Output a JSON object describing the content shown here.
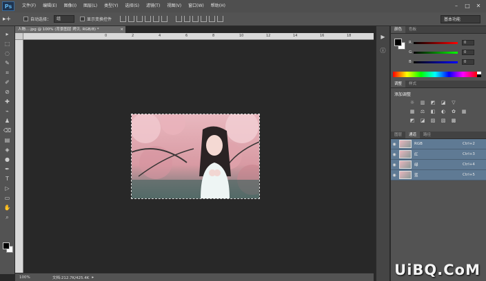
{
  "app": {
    "logo": "Ps",
    "menu": [
      "文件(F)",
      "编辑(E)",
      "图像(I)",
      "图层(L)",
      "类型(Y)",
      "选择(S)",
      "滤镜(T)",
      "视图(V)",
      "窗口(W)",
      "帮助(H)"
    ],
    "window_controls": [
      "–",
      "□",
      "✕"
    ]
  },
  "options": {
    "tool_glyph": "▸+",
    "auto_select_label": "自动选择：",
    "auto_select_value": "组",
    "show_transform_label": "显示变换控件",
    "workspace": "基本功能"
  },
  "tools": [
    "▸",
    "⬚",
    "◌",
    "✎",
    "⌗",
    "✐",
    "⊘",
    "✚",
    "⌁",
    "♟",
    "⌫",
    "▤",
    "◈",
    "●",
    "✒",
    "T",
    "▷",
    "▭",
    "✋",
    "⌕"
  ],
  "document": {
    "tab_title": "人物….jpg @ 100% (背景图层 拷贝, RGB/8) *",
    "ruler_ticks": [
      "0",
      "2",
      "4",
      "6",
      "8",
      "10",
      "12",
      "14",
      "16",
      "18",
      "20"
    ]
  },
  "status": {
    "zoom": "100%",
    "doc_info": "文档:212.7K/425.4K",
    "arrow": "▸"
  },
  "panels": {
    "color_tabs": [
      "颜色",
      "色板"
    ],
    "sliders": [
      {
        "label": "R",
        "value": "0"
      },
      {
        "label": "G",
        "value": "0"
      },
      {
        "label": "B",
        "value": "0"
      }
    ],
    "adj_tabs": [
      "调整",
      "样式"
    ],
    "adj_title": "添加调整",
    "adj_row1": [
      "☼",
      "▥",
      "◩",
      "◪",
      "▽"
    ],
    "adj_row2": [
      "▦",
      "⚖",
      "◧",
      "◐",
      "✿",
      "▦"
    ],
    "adj_row3": [
      "◩",
      "◪",
      "▨",
      "▧",
      "▩"
    ],
    "channel_tabs": [
      "图层",
      "通道",
      "路径"
    ],
    "channels": [
      {
        "name": "RGB",
        "shortcut": "Ctrl+2"
      },
      {
        "name": "红",
        "shortcut": "Ctrl+3"
      },
      {
        "name": "绿",
        "shortcut": "Ctrl+4"
      },
      {
        "name": "蓝",
        "shortcut": "Ctrl+5"
      }
    ]
  },
  "watermark": "UiBQ.CoM"
}
